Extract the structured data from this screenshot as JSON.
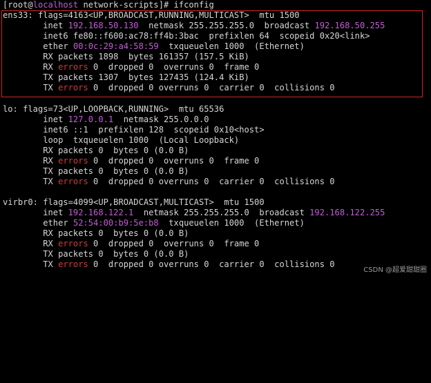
{
  "colors": {
    "background": "#000000",
    "text": "#d6d6d6",
    "ip_highlight": "#c35cd6",
    "error_highlight": "#d23a3a",
    "box_outline": "#d22626"
  },
  "prompt": {
    "open": "[root@",
    "host": "localhost",
    "rest": " network-scripts]# ifconfig"
  },
  "ens33": {
    "l1": "ens33: flags=4163<UP,BROADCAST,RUNNING,MULTICAST>  mtu 1500",
    "l2_a": "        inet ",
    "l2_ip": "192.168.50.130",
    "l2_b": "  netmask 255.255.255.0  broadcast ",
    "l2_bc": "192.168.50.255",
    "l3": "        inet6 fe80::f600:ac78:ff4b:3bac  prefixlen 64  scopeid 0x20<link>",
    "l4_a": "        ether ",
    "l4_mac": "00:0c:29:a4:58:59",
    "l4_b": "  txqueuelen 1000  (Ethernet)",
    "l5": "        RX packets 1898  bytes 161357 (157.5 KiB)",
    "l6_a": "        RX ",
    "l6_err": "errors",
    "l6_b": " 0  dropped 0  overruns 0  frame 0",
    "l7": "        TX packets 1307  bytes 127435 (124.4 KiB)",
    "l8_a": "        TX ",
    "l8_err": "errors",
    "l8_b": " 0  dropped 0 overruns 0  carrier 0  collisions 0"
  },
  "lo": {
    "l1": "lo: flags=73<UP,LOOPBACK,RUNNING>  mtu 65536",
    "l2_a": "        inet ",
    "l2_ip": "127.0.0.1",
    "l2_b": "  netmask 255.0.0.0",
    "l3": "        inet6 ::1  prefixlen 128  scopeid 0x10<host>",
    "l4": "        loop  txqueuelen 1000  (Local Loopback)",
    "l5": "        RX packets 0  bytes 0 (0.0 B)",
    "l6_a": "        RX ",
    "l6_err": "errors",
    "l6_b": " 0  dropped 0  overruns 0  frame 0",
    "l7": "        TX packets 0  bytes 0 (0.0 B)",
    "l8_a": "        TX ",
    "l8_err": "errors",
    "l8_b": " 0  dropped 0 overruns 0  carrier 0  collisions 0"
  },
  "virbr0": {
    "l1": "virbr0: flags=4099<UP,BROADCAST,MULTICAST>  mtu 1500",
    "l2_a": "        inet ",
    "l2_ip": "192.168.122.1",
    "l2_b": "  netmask 255.255.255.0  broadcast ",
    "l2_bc": "192.168.122.255",
    "l3_a": "        ether ",
    "l3_mac": "52:54:00:b9:5e:b8",
    "l3_b": "  txqueuelen 1000  (Ethernet)",
    "l4": "        RX packets 0  bytes 0 (0.0 B)",
    "l5_a": "        RX ",
    "l5_err": "errors",
    "l5_b": " 0  dropped 0  overruns 0  frame 0",
    "l6": "        TX packets 0  bytes 0 (0.0 B)",
    "l7_a": "        TX ",
    "l7_err": "errors",
    "l7_b": " 0  dropped 0 overruns 0  carrier 0  collisions 0"
  },
  "watermark": "CSDN @超爱甜甜圈"
}
